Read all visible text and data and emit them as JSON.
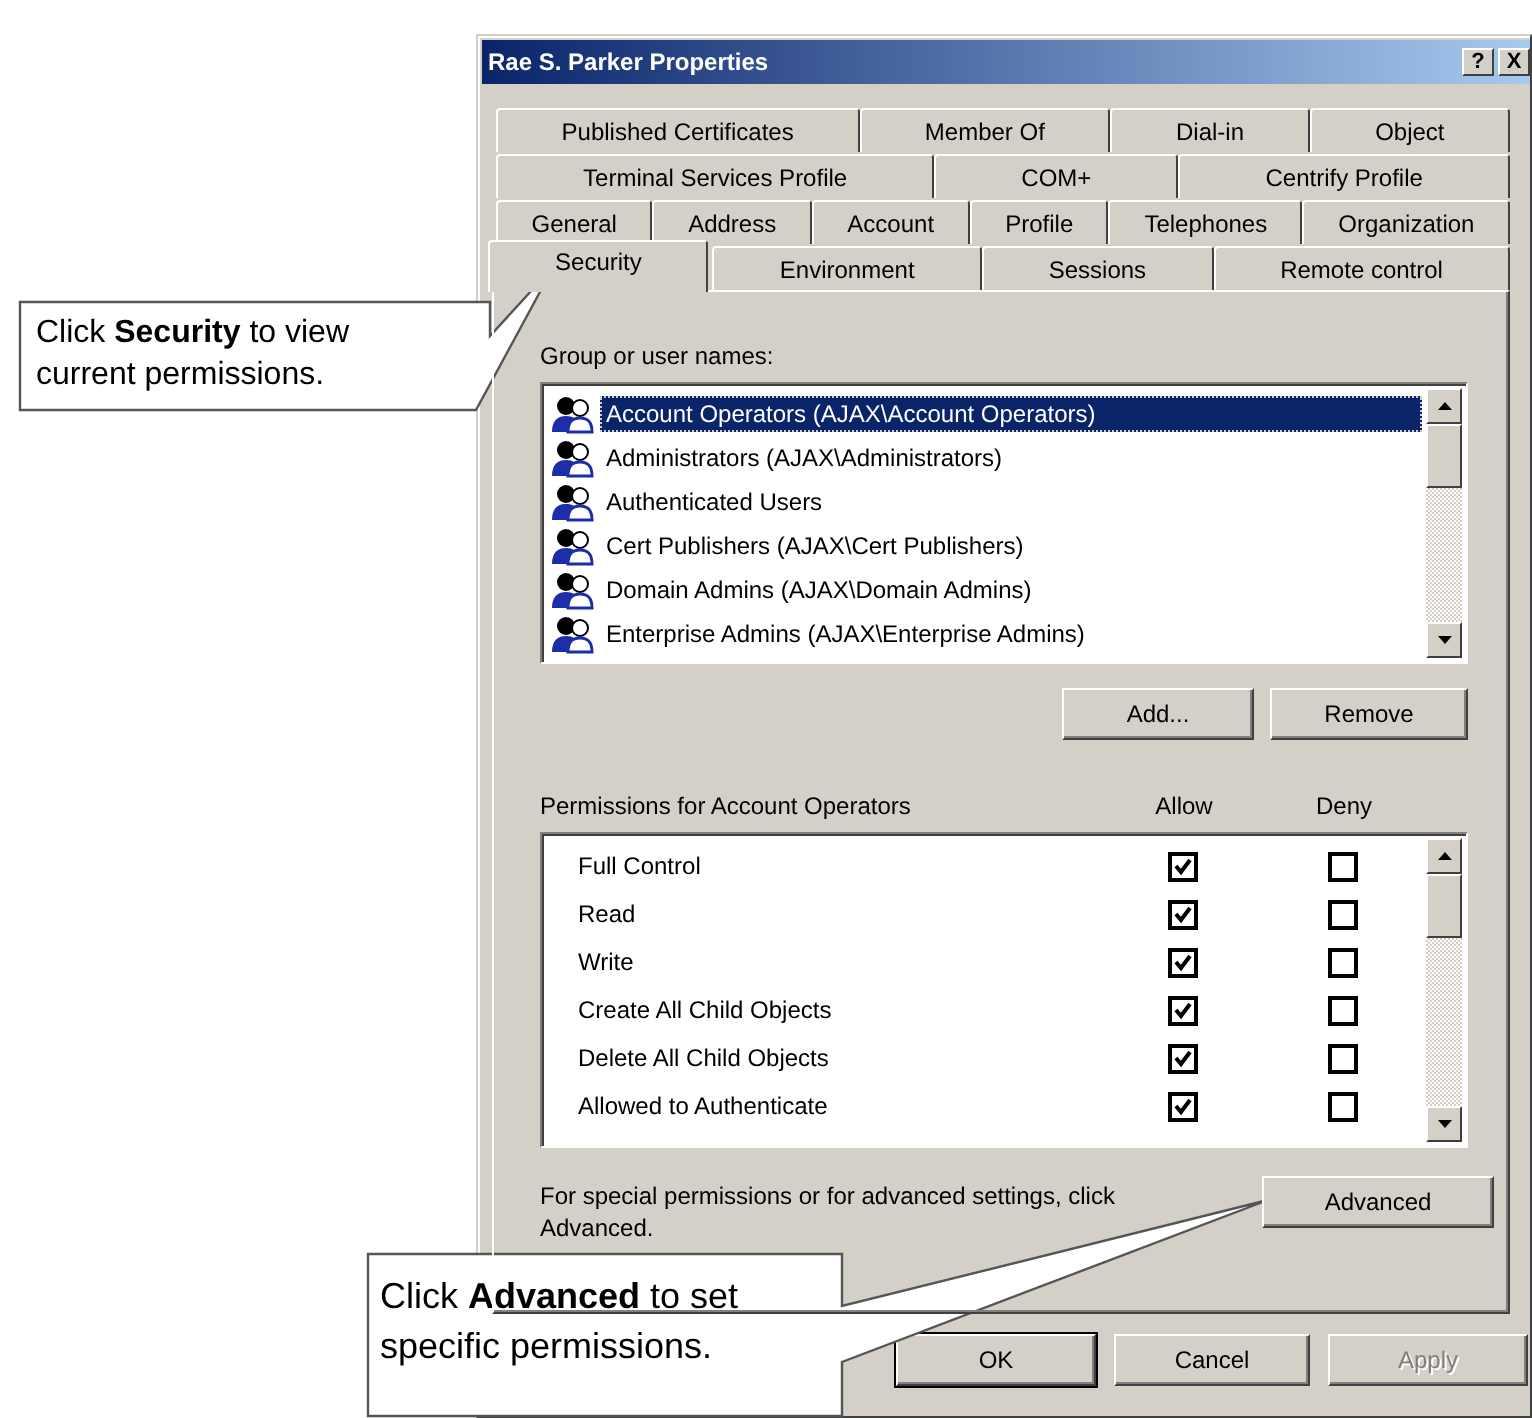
{
  "window": {
    "title": "Rae S. Parker Properties",
    "buttons": [
      "?",
      "X"
    ]
  },
  "tab_rows": [
    {
      "tabs": [
        {
          "label": "Published Certificates",
          "selected": false
        },
        {
          "label": "Member Of",
          "selected": false
        },
        {
          "label": "Dial-in",
          "selected": false
        },
        {
          "label": "Object",
          "selected": false
        }
      ]
    },
    {
      "tabs": [
        {
          "label": "Terminal Services Profile",
          "selected": false
        },
        {
          "label": "COM+",
          "selected": false
        },
        {
          "label": "Centrify Profile",
          "selected": false
        }
      ]
    },
    {
      "tabs": [
        {
          "label": "General",
          "selected": false
        },
        {
          "label": "Address",
          "selected": false
        },
        {
          "label": "Account",
          "selected": false
        },
        {
          "label": "Profile",
          "selected": false
        },
        {
          "label": "Telephones",
          "selected": false
        },
        {
          "label": "Organization",
          "selected": false
        }
      ]
    },
    {
      "tabs": [
        {
          "label": "Security",
          "selected": true
        },
        {
          "label": "Environment",
          "selected": false
        },
        {
          "label": "Sessions",
          "selected": false
        },
        {
          "label": "Remote control",
          "selected": false
        }
      ]
    }
  ],
  "group_list": {
    "label": "Group or user names:",
    "items": [
      {
        "name": "Account Operators (AJAX\\Account Operators)",
        "selected": true
      },
      {
        "name": "Administrators (AJAX\\Administrators)",
        "selected": false
      },
      {
        "name": "Authenticated Users",
        "selected": false
      },
      {
        "name": "Cert Publishers (AJAX\\Cert Publishers)",
        "selected": false
      },
      {
        "name": "Domain Admins (AJAX\\Domain Admins)",
        "selected": false
      },
      {
        "name": "Enterprise Admins (AJAX\\Enterprise Admins)",
        "selected": false
      }
    ]
  },
  "group_buttons": [
    "Add...",
    "Remove"
  ],
  "permissions": {
    "label": "Permissions for Account Operators",
    "columns": [
      "Allow",
      "Deny"
    ],
    "rows": [
      {
        "name": "Full Control",
        "allow": true,
        "deny": false
      },
      {
        "name": "Read",
        "allow": true,
        "deny": false
      },
      {
        "name": "Write",
        "allow": true,
        "deny": false
      },
      {
        "name": "Create All Child Objects",
        "allow": true,
        "deny": false
      },
      {
        "name": "Delete All Child Objects",
        "allow": true,
        "deny": false
      },
      {
        "name": "Allowed to Authenticate",
        "allow": true,
        "deny": false
      }
    ]
  },
  "note": "For special permissions or for advanced settings, click Advanced.",
  "advanced_button": "Advanced",
  "footer_buttons": [
    {
      "label": "OK",
      "default": true,
      "disabled": false
    },
    {
      "label": "Cancel",
      "default": false,
      "disabled": false
    },
    {
      "label": "Apply",
      "default": false,
      "disabled": true
    }
  ],
  "callouts": [
    {
      "text": "Click **Security** to view current permissions."
    },
    {
      "text": "Click **Advanced** to set specific permissions."
    }
  ]
}
